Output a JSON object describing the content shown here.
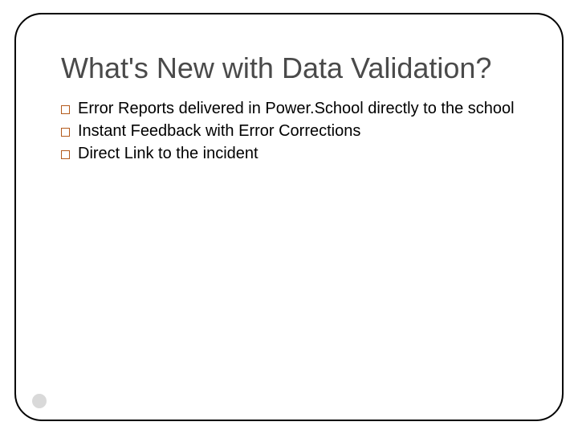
{
  "title": "What's New with Data Validation?",
  "bullets": [
    "Error Reports delivered in Power.School directly to the school",
    "Instant Feedback with Error Corrections",
    "Direct Link to the incident"
  ]
}
